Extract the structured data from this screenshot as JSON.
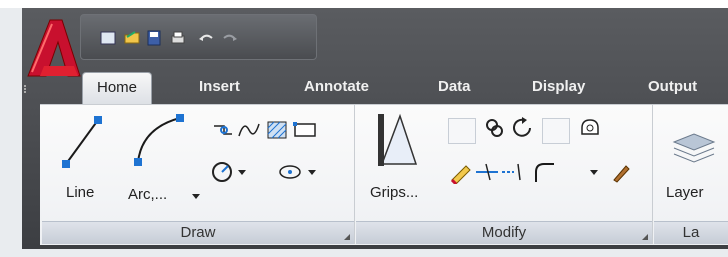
{
  "app": {
    "logo_icon": "autocad-a-logo",
    "accent": "#c8102e"
  },
  "qat": {
    "icons": [
      "new-icon",
      "open-icon",
      "save-icon",
      "plot-icon",
      "undo-icon",
      "redo-icon"
    ]
  },
  "tabs": [
    {
      "label": "Home",
      "active": true
    },
    {
      "label": "Insert"
    },
    {
      "label": "Annotate"
    },
    {
      "label": "Data"
    },
    {
      "label": "Display"
    },
    {
      "label": "Output"
    }
  ],
  "panels": {
    "draw": {
      "title": "Draw",
      "line_label": "Line",
      "arc_label": "Arc,..."
    },
    "modify": {
      "title": "Modify",
      "grips_label": "Grips..."
    },
    "layers": {
      "label": "Layer",
      "title": "La"
    }
  }
}
